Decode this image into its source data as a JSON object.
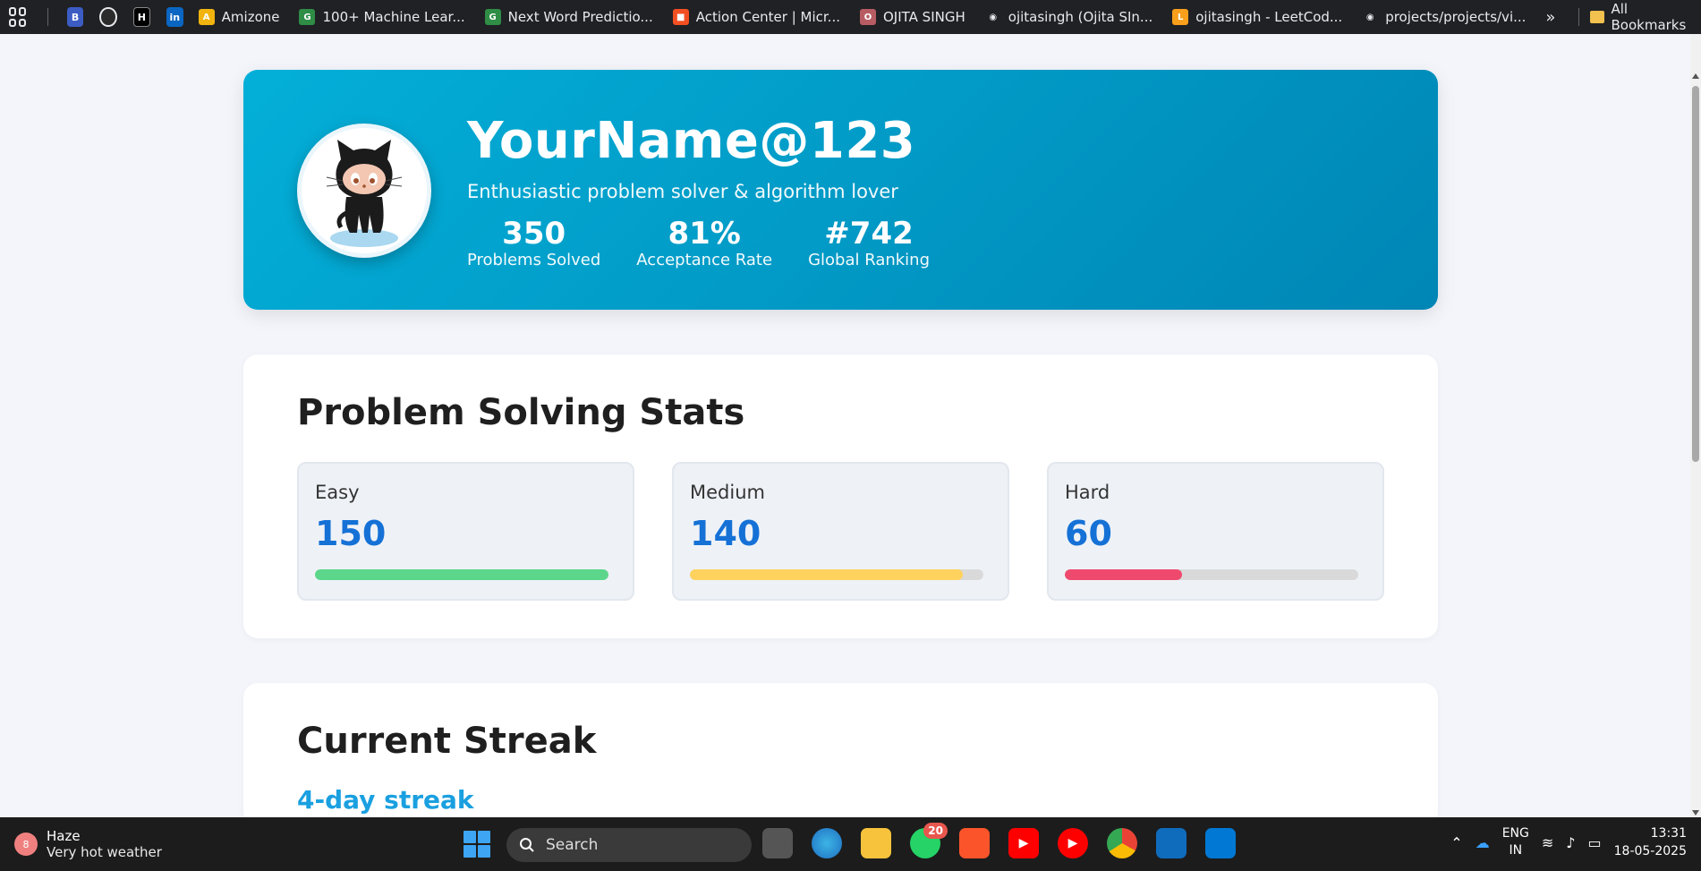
{
  "bookmarks": {
    "items": [
      {
        "label": "Amizone",
        "color": "#f1b40f",
        "glyph": "A"
      },
      {
        "label": "100+ Machine Lear...",
        "color": "#2f8d46",
        "glyph": "G"
      },
      {
        "label": "Next Word Predictio...",
        "color": "#2f8d46",
        "glyph": "G"
      },
      {
        "label": "Action Center | Micr...",
        "color": "#f25022",
        "glyph": "■"
      },
      {
        "label": "OJITA SINGH",
        "color": "#b85c63",
        "glyph": "O"
      },
      {
        "label": "ojitasingh (Ojita SIn...",
        "color": "#e8eaed",
        "glyph": "◉"
      },
      {
        "label": "ojitasingh - LeetCod...",
        "color": "#f89f1b",
        "glyph": "L"
      },
      {
        "label": "projects/projects/vi...",
        "color": "#e8eaed",
        "glyph": "◉"
      }
    ],
    "more": "»",
    "all_label": "All Bookmarks"
  },
  "profile": {
    "username": "YourName@123",
    "tagline": "Enthusiastic problem solver & algorithm lover",
    "stats": [
      {
        "value": "350",
        "label": "Problems Solved"
      },
      {
        "value": "81%",
        "label": "Acceptance Rate"
      },
      {
        "value": "#742",
        "label": "Global Ranking"
      }
    ]
  },
  "problem_stats": {
    "title": "Problem Solving Stats",
    "difficulties": [
      {
        "name": "Easy",
        "count": "150",
        "progress": 1.0,
        "color": "#5cd68b"
      },
      {
        "name": "Medium",
        "count": "140",
        "progress": 0.93,
        "color": "#ffd25e"
      },
      {
        "name": "Hard",
        "count": "60",
        "progress": 0.4,
        "color": "#ef4a6e"
      }
    ]
  },
  "streak": {
    "title": "Current Streak",
    "text": "4-day streak"
  },
  "taskbar": {
    "weather_temp": "8",
    "weather_title": "Haze",
    "weather_desc": "Very hot weather",
    "search_placeholder": "Search",
    "whatsapp_badge": "20",
    "lang_line1": "ENG",
    "lang_line2": "IN",
    "time": "13:31",
    "date": "18-05-2025"
  }
}
